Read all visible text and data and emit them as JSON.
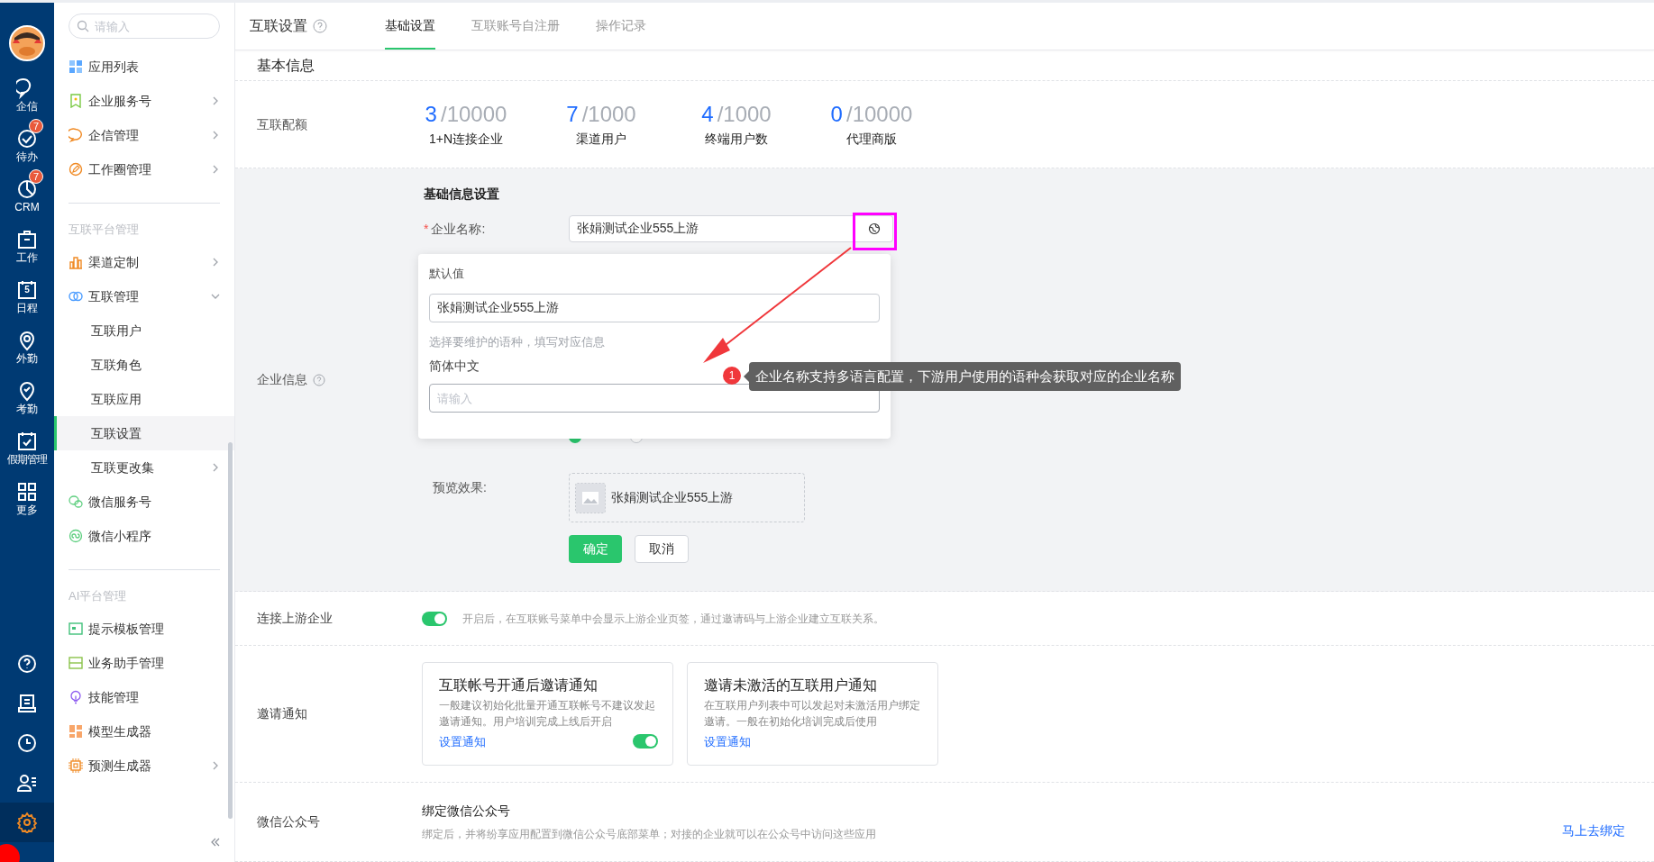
{
  "rail": {
    "items": [
      {
        "label": "企信"
      },
      {
        "label": "待办",
        "badge": "7"
      },
      {
        "label": "CRM",
        "badge": "7"
      },
      {
        "label": "工作"
      },
      {
        "label": "日程",
        "day": "5"
      },
      {
        "label": "外勤"
      },
      {
        "label": "考勤"
      },
      {
        "label": "假期管理"
      },
      {
        "label": "更多"
      }
    ],
    "bottom": [
      {
        "selected": false
      },
      {
        "selected": false
      },
      {
        "selected": false
      },
      {
        "selected": false
      },
      {
        "selected": true
      }
    ]
  },
  "sidebar": {
    "search": {
      "placeholder": "请输入"
    },
    "sections": [
      {
        "items": [
          {
            "label": "应用列表",
            "selected": false
          },
          {
            "label": "企业服务号",
            "selected": false,
            "expanded": false
          },
          {
            "label": "企信管理",
            "selected": false,
            "expanded": false
          },
          {
            "label": "工作圈管理",
            "selected": false,
            "expanded": false
          }
        ]
      },
      {
        "heading": "互联平台管理",
        "items": [
          {
            "label": "渠道定制",
            "selected": false,
            "expanded": false
          },
          {
            "label": "互联管理",
            "selected": false,
            "expanded": true,
            "children": [
              {
                "label": "互联用户",
                "selected": false
              },
              {
                "label": "互联角色",
                "selected": false
              },
              {
                "label": "互联应用",
                "selected": false
              },
              {
                "label": "互联设置",
                "selected": true
              },
              {
                "label": "互联更改集",
                "selected": false,
                "expanded": false
              }
            ]
          },
          {
            "label": "微信服务号",
            "selected": false
          },
          {
            "label": "微信小程序",
            "selected": false
          }
        ]
      },
      {
        "heading": "AI平台管理",
        "items": [
          {
            "label": "提示模板管理",
            "selected": false
          },
          {
            "label": "业务助手管理",
            "selected": false
          },
          {
            "label": "技能管理",
            "selected": false
          },
          {
            "label": "模型生成器",
            "selected": false
          },
          {
            "label": "预测生成器",
            "selected": false,
            "expanded": false
          }
        ]
      }
    ]
  },
  "header": {
    "title": "互联设置",
    "tabs": [
      {
        "label": "基础设置",
        "selected": true
      },
      {
        "label": "互联账号自注册",
        "selected": false
      },
      {
        "label": "操作记录",
        "selected": false
      }
    ]
  },
  "basic_info": {
    "heading": "基本信息",
    "quota_label": "互联配额",
    "quotas": [
      {
        "used": "3",
        "total": "/10000",
        "label": "1+N连接企业"
      },
      {
        "used": "7",
        "total": "/1000",
        "label": "渠道用户"
      },
      {
        "used": "4",
        "total": "/1000",
        "label": "终端用户数"
      },
      {
        "used": "0",
        "total": "/10000",
        "label": "代理商版"
      }
    ]
  },
  "company_info": {
    "label": "企业信息",
    "heading": "基础信息设置",
    "name_field": {
      "label": "企业名称:",
      "required_mark": "*",
      "value": "张娟测试企业555上游"
    },
    "radios": [
      {
        "selected": true
      },
      {
        "selected": false
      }
    ],
    "popup": {
      "default_label": "默认值",
      "default_value": "张娟测试企业555上游",
      "hint": "选择要维护的语种，填写对应信息",
      "language": "简体中文",
      "placeholder": "请输入"
    },
    "preview": {
      "label": "预览效果:",
      "name": "张娟测试企业555上游"
    },
    "buttons": [
      "确定",
      "取消"
    ]
  },
  "annotation": {
    "number": "1",
    "text": "企业名称支持多语言配置，下游用户使用的语种会获取对应的企业名称"
  },
  "upstream": {
    "label": "连接上游企业",
    "on": true,
    "description": "开启后，在互联账号菜单中会显示上游企业页签，通过邀请码与上游企业建立互联关系。"
  },
  "invite": {
    "label": "邀请通知",
    "cards": [
      {
        "title": "互联帐号开通后邀请通知",
        "description": "一般建议初始化批量开通互联帐号不建议发起邀请通知。用户培训完成上线后开启",
        "link": "设置通知",
        "switch": {
          "on": true
        }
      },
      {
        "title": "邀请未激活的互联用户通知",
        "description": "在互联用户列表中可以发起对未激活用户绑定邀请。一般在初始化培训完成后使用",
        "link": "设置通知"
      }
    ]
  },
  "wechat": {
    "label": "微信公众号",
    "title": "绑定微信公众号",
    "description": "绑定后，并将纷享应用配置到微信公众号底部菜单；对接的企业就可以在公众号中访问这些应用",
    "link": "马上去绑定"
  }
}
